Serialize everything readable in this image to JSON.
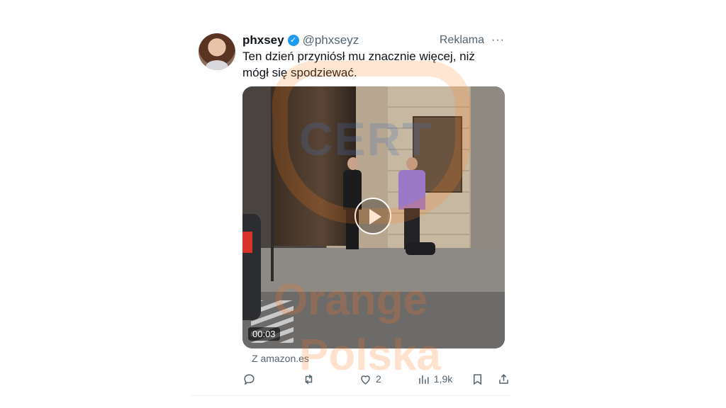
{
  "tweet": {
    "author_name": "phxsey",
    "author_handle": "@phxseyz",
    "ad_label": "Reklama",
    "more_label": "···",
    "text_line1": "Ten dzień przyniósł mu znacznie więcej, niż",
    "text_line2": "mógł się spodziewać.",
    "verified": true
  },
  "video": {
    "duration": "00:03",
    "play_icon": "play-icon"
  },
  "source": "Z amazon.es",
  "actions": {
    "reply_count": "",
    "retweet_count": "",
    "like_count": "2",
    "view_count": "1,9k",
    "icons": [
      "reply-icon",
      "retweet-icon",
      "like-icon",
      "views-icon",
      "bookmark-icon",
      "share-icon"
    ]
  },
  "watermark": {
    "line1": "CERT",
    "line2": "Orange",
    "line3": "Polska"
  },
  "colors": {
    "text": "#0f1419",
    "muted": "#536471",
    "verified": "#1d9bf0",
    "watermark_orange": "#ff7820"
  }
}
